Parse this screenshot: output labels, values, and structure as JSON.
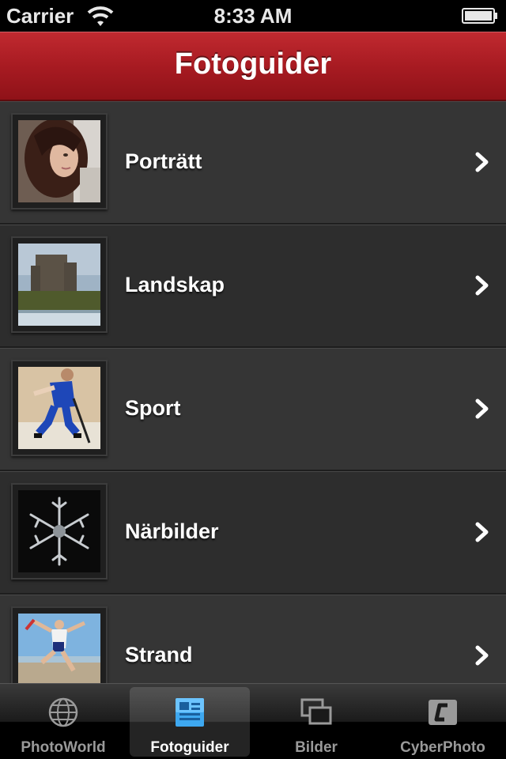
{
  "status_bar": {
    "carrier": "Carrier",
    "time": "8:33 AM",
    "icons": [
      "wifi-icon",
      "battery-icon"
    ]
  },
  "nav": {
    "title": "Fotoguider",
    "accent_color": "#a81b22"
  },
  "list": {
    "items": [
      {
        "label": "Porträtt",
        "thumbnail": "portrait-photo"
      },
      {
        "label": "Landskap",
        "thumbnail": "castle-landscape-photo"
      },
      {
        "label": "Sport",
        "thumbnail": "floorball-player-photo"
      },
      {
        "label": "Närbilder",
        "thumbnail": "snowflake-macro-photo"
      },
      {
        "label": "Strand",
        "thumbnail": "beach-jump-photo"
      }
    ],
    "disclosure_icon": "chevron-right-icon"
  },
  "tab_bar": {
    "tabs": [
      {
        "label": "PhotoWorld",
        "icon": "globe-icon",
        "selected": false
      },
      {
        "label": "Fotoguider",
        "icon": "guide-icon",
        "selected": true
      },
      {
        "label": "Bilder",
        "icon": "gallery-icon",
        "selected": false
      },
      {
        "label": "CyberPhoto",
        "icon": "cyberphoto-logo-icon",
        "selected": false
      }
    ]
  }
}
